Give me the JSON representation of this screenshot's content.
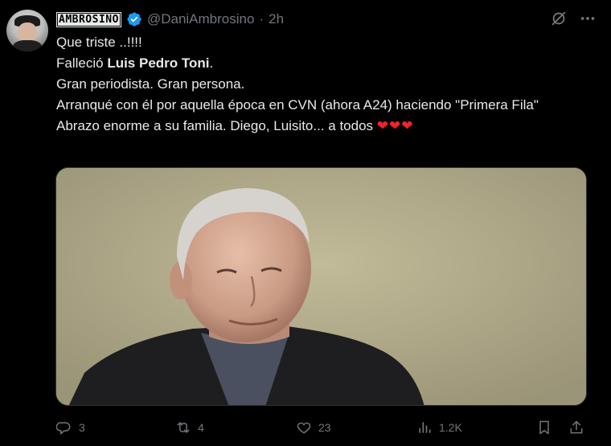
{
  "author": {
    "display_name": "AMBROSINO",
    "handle": "@DaniAmbrosino",
    "separator": "·",
    "time": "2h"
  },
  "tweet": {
    "line1": "Que triste ..!!!!",
    "line2_pre": "Falleció ",
    "line2_bold": "Luis Pedro Toni",
    "line2_post": ".",
    "line3": "Gran periodista. Gran persona.",
    "line4": "Arranqué con él por aquella época  en CVN (ahora A24) haciendo \"Primera Fila\"",
    "line5": "Abrazo enorme a su familia. Diego, Luisito... a todos",
    "hearts": "❤❤❤"
  },
  "actions": {
    "replies": "3",
    "reposts": "4",
    "likes": "23",
    "views": "1.2K"
  },
  "icons": [
    "verified-badge-icon",
    "grok-icon",
    "more-icon",
    "reply-icon",
    "repost-icon",
    "like-icon",
    "views-icon",
    "bookmark-icon",
    "share-icon"
  ],
  "colors": {
    "background": "#000000",
    "text": "#e7e9ea",
    "muted": "#71767b",
    "verified": "#1d9bf0",
    "heart": "#f4212e"
  }
}
